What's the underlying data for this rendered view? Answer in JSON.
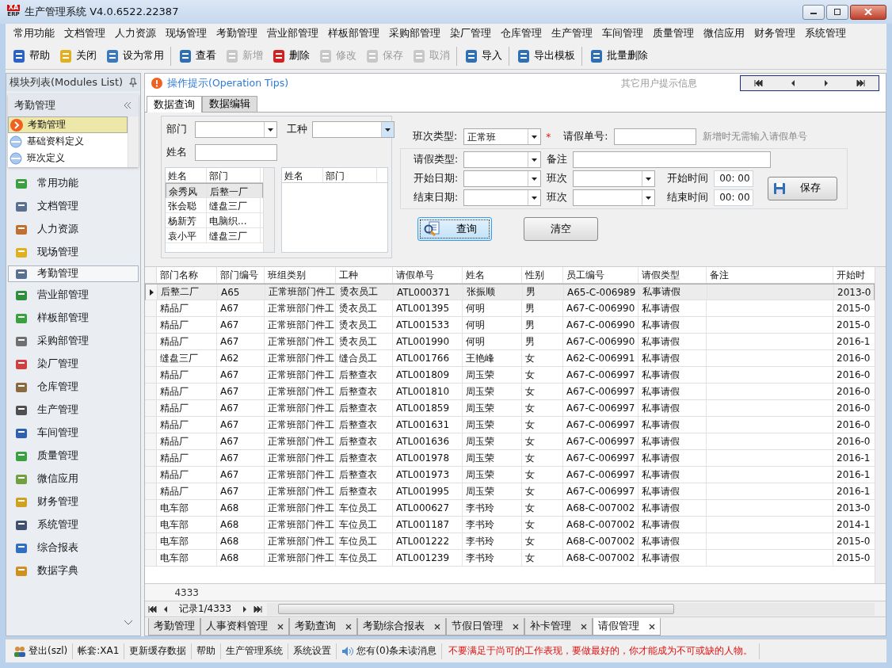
{
  "window": {
    "title": "生产管理系统 V4.0.6522.22387",
    "logo_top": "XA",
    "logo_bottom": "ERP"
  },
  "menu": [
    "常用功能",
    "文档管理",
    "人力资源",
    "现场管理",
    "考勤管理",
    "营业部管理",
    "样板部管理",
    "采购部管理",
    "染厂管理",
    "仓库管理",
    "生产管理",
    "车间管理",
    "质量管理",
    "微信应用",
    "财务管理",
    "系统管理"
  ],
  "toolbar": [
    [
      {
        "label": "帮助",
        "disabled": false
      },
      {
        "label": "关闭",
        "disabled": false
      },
      {
        "label": "设为常用",
        "disabled": false
      }
    ],
    [
      {
        "label": "查看",
        "disabled": false
      },
      {
        "label": "新增",
        "disabled": true
      },
      {
        "label": "删除",
        "disabled": false
      },
      {
        "label": "修改",
        "disabled": true
      },
      {
        "label": "保存",
        "disabled": true
      },
      {
        "label": "取消",
        "disabled": true
      }
    ],
    [
      {
        "label": "导入",
        "disabled": false
      }
    ],
    [
      {
        "label": "导出模板",
        "disabled": false
      }
    ],
    [
      {
        "label": "批量删除",
        "disabled": false
      }
    ]
  ],
  "sidebar": {
    "title": "模块列表(Modules List)",
    "group_title": "考勤管理",
    "tree": [
      {
        "label": "考勤管理",
        "selected": true
      },
      {
        "label": "基础资料定义",
        "selected": false
      },
      {
        "label": "班次定义",
        "selected": false
      }
    ],
    "items": [
      {
        "label": "常用功能",
        "selected": false
      },
      {
        "label": "文档管理",
        "selected": false
      },
      {
        "label": "人力资源",
        "selected": false
      },
      {
        "label": "现场管理",
        "selected": false
      },
      {
        "label": "考勤管理",
        "selected": true
      },
      {
        "label": "营业部管理",
        "selected": false
      },
      {
        "label": "样板部管理",
        "selected": false
      },
      {
        "label": "采购部管理",
        "selected": false
      },
      {
        "label": "染厂管理",
        "selected": false
      },
      {
        "label": "仓库管理",
        "selected": false
      },
      {
        "label": "生产管理",
        "selected": false
      },
      {
        "label": "车间管理",
        "selected": false
      },
      {
        "label": "质量管理",
        "selected": false
      },
      {
        "label": "微信应用",
        "selected": false
      },
      {
        "label": "财务管理",
        "selected": false
      },
      {
        "label": "系统管理",
        "selected": false
      },
      {
        "label": "综合报表",
        "selected": false
      },
      {
        "label": "数据字典",
        "selected": false
      }
    ]
  },
  "tips": {
    "title": "操作提示(Operation Tips)",
    "other_info": "其它用户提示信息"
  },
  "tabs": [
    {
      "label": "数据查询",
      "selected": true
    },
    {
      "label": "数据编辑",
      "selected": false
    }
  ],
  "query_filter": {
    "dept_label": "部门",
    "work_type_label": "工种",
    "name_label": "姓名",
    "left_list": {
      "columns": [
        "姓名",
        "部门"
      ],
      "rows": [
        {
          "cells": [
            "余秀风",
            "后整一厂"
          ],
          "selected": true
        },
        {
          "cells": [
            "张会聪",
            "缝盘三厂"
          ],
          "selected": false
        },
        {
          "cells": [
            "杨新芳",
            "电脑织..."
          ],
          "selected": false
        },
        {
          "cells": [
            "袁小平",
            "缝盘三厂"
          ],
          "selected": false
        }
      ]
    },
    "right_list": {
      "columns": [
        "姓名",
        "部门"
      ]
    }
  },
  "leave_form": {
    "shift_type": {
      "label": "班次类型:",
      "value": "正常班",
      "required_mark": "*"
    },
    "leave_no": {
      "label": "请假单号:",
      "hint": "新增时无需输入请假单号"
    },
    "leave_type": {
      "label": "请假类型:"
    },
    "remark": {
      "label": "备注"
    },
    "start_date": {
      "label": "开始日期:"
    },
    "start_shift": {
      "label": "班次"
    },
    "start_time": {
      "label": "开始时间",
      "value": "00: 00"
    },
    "end_date": {
      "label": "结束日期:"
    },
    "end_shift": {
      "label": "班次"
    },
    "end_time": {
      "label": "结束时间",
      "value": "00: 00"
    },
    "save_button": "保存"
  },
  "query_button": {
    "label": "查询",
    "focused": true
  },
  "clear_button": {
    "label": "清空",
    "focused": false
  },
  "table": {
    "columns": [
      "部门名称",
      "部门编号",
      "班组类别",
      "工种",
      "请假单号",
      "姓名",
      "性别",
      "员工编号",
      "请假类型",
      "备注",
      "开始时"
    ],
    "rows": [
      {
        "selected": true,
        "cells": [
          "后整二厂",
          "A65",
          "正常班部门件工",
          "烫衣员工",
          "ATL000371",
          "张振顺",
          "男",
          "A65-C-006989",
          "私事请假",
          "",
          "2013-0"
        ]
      },
      {
        "selected": false,
        "cells": [
          "精品厂",
          "A67",
          "正常班部门件工",
          "烫衣员工",
          "ATL001395",
          "何明",
          "男",
          "A67-C-006990",
          "私事请假",
          "",
          "2015-0"
        ]
      },
      {
        "selected": false,
        "cells": [
          "精品厂",
          "A67",
          "正常班部门件工",
          "烫衣员工",
          "ATL001533",
          "何明",
          "男",
          "A67-C-006990",
          "私事请假",
          "",
          "2015-0"
        ]
      },
      {
        "selected": false,
        "cells": [
          "精品厂",
          "A67",
          "正常班部门件工",
          "烫衣员工",
          "ATL001990",
          "何明",
          "男",
          "A67-C-006990",
          "私事请假",
          "",
          "2016-1"
        ]
      },
      {
        "selected": false,
        "cells": [
          "缝盘三厂",
          "A62",
          "正常班部门件工",
          "缝合员工",
          "ATL001766",
          "王艳峰",
          "女",
          "A62-C-006991",
          "私事请假",
          "",
          "2016-0"
        ]
      },
      {
        "selected": false,
        "cells": [
          "精品厂",
          "A67",
          "正常班部门件工",
          "后整查衣",
          "ATL001809",
          "周玉荣",
          "女",
          "A67-C-006997",
          "私事请假",
          "",
          "2016-0"
        ]
      },
      {
        "selected": false,
        "cells": [
          "精品厂",
          "A67",
          "正常班部门件工",
          "后整查衣",
          "ATL001810",
          "周玉荣",
          "女",
          "A67-C-006997",
          "私事请假",
          "",
          "2016-0"
        ]
      },
      {
        "selected": false,
        "cells": [
          "精品厂",
          "A67",
          "正常班部门件工",
          "后整查衣",
          "ATL001859",
          "周玉荣",
          "女",
          "A67-C-006997",
          "私事请假",
          "",
          "2016-0"
        ]
      },
      {
        "selected": false,
        "cells": [
          "精品厂",
          "A67",
          "正常班部门件工",
          "后整查衣",
          "ATL001631",
          "周玉荣",
          "女",
          "A67-C-006997",
          "私事请假",
          "",
          "2016-0"
        ]
      },
      {
        "selected": false,
        "cells": [
          "精品厂",
          "A67",
          "正常班部门件工",
          "后整查衣",
          "ATL001636",
          "周玉荣",
          "女",
          "A67-C-006997",
          "私事请假",
          "",
          "2016-0"
        ]
      },
      {
        "selected": false,
        "cells": [
          "精品厂",
          "A67",
          "正常班部门件工",
          "后整查衣",
          "ATL001978",
          "周玉荣",
          "女",
          "A67-C-006997",
          "私事请假",
          "",
          "2016-1"
        ]
      },
      {
        "selected": false,
        "cells": [
          "精品厂",
          "A67",
          "正常班部门件工",
          "后整查衣",
          "ATL001973",
          "周玉荣",
          "女",
          "A67-C-006997",
          "私事请假",
          "",
          "2016-1"
        ]
      },
      {
        "selected": false,
        "cells": [
          "精品厂",
          "A67",
          "正常班部门件工",
          "后整查衣",
          "ATL001995",
          "周玉荣",
          "女",
          "A67-C-006997",
          "私事请假",
          "",
          "2016-1"
        ]
      },
      {
        "selected": false,
        "cells": [
          "电车部",
          "A68",
          "正常班部门件工",
          "车位员工",
          "ATL000627",
          "李书玲",
          "女",
          "A68-C-007002",
          "私事请假",
          "",
          "2013-0"
        ]
      },
      {
        "selected": false,
        "cells": [
          "电车部",
          "A68",
          "正常班部门件工",
          "车位员工",
          "ATL001187",
          "李书玲",
          "女",
          "A68-C-007002",
          "私事请假",
          "",
          "2014-1"
        ]
      },
      {
        "selected": false,
        "cells": [
          "电车部",
          "A68",
          "正常班部门件工",
          "车位员工",
          "ATL001222",
          "李书玲",
          "女",
          "A68-C-007002",
          "私事请假",
          "",
          "2015-0"
        ]
      },
      {
        "selected": false,
        "cells": [
          "电车部",
          "A68",
          "正常班部门件工",
          "车位员工",
          "ATL001239",
          "李书玲",
          "女",
          "A68-C-007002",
          "私事请假",
          "",
          "2015-0"
        ]
      }
    ],
    "footer_count": "4333",
    "record_nav": "记录1/4333"
  },
  "doc_tabs": [
    {
      "label": "考勤管理",
      "closable": false,
      "selected": false
    },
    {
      "label": "人事资料管理",
      "closable": true,
      "selected": false
    },
    {
      "label": "考勤查询",
      "closable": true,
      "selected": false
    },
    {
      "label": "考勤综合报表",
      "closable": true,
      "selected": false
    },
    {
      "label": "节假日管理",
      "closable": true,
      "selected": false
    },
    {
      "label": "补卡管理",
      "closable": true,
      "selected": false
    },
    {
      "label": "请假管理",
      "closable": true,
      "selected": true
    }
  ],
  "status_bar": {
    "items": [
      "登出(szl)",
      "帐套:XA1",
      "更新缓存数据",
      "帮助",
      "生产管理系统",
      "系统设置",
      "您有(0)条未读消息"
    ],
    "message": "不要满足于尚可的工作表现，要做最好的，你才能成为不可或缺的人物。"
  }
}
